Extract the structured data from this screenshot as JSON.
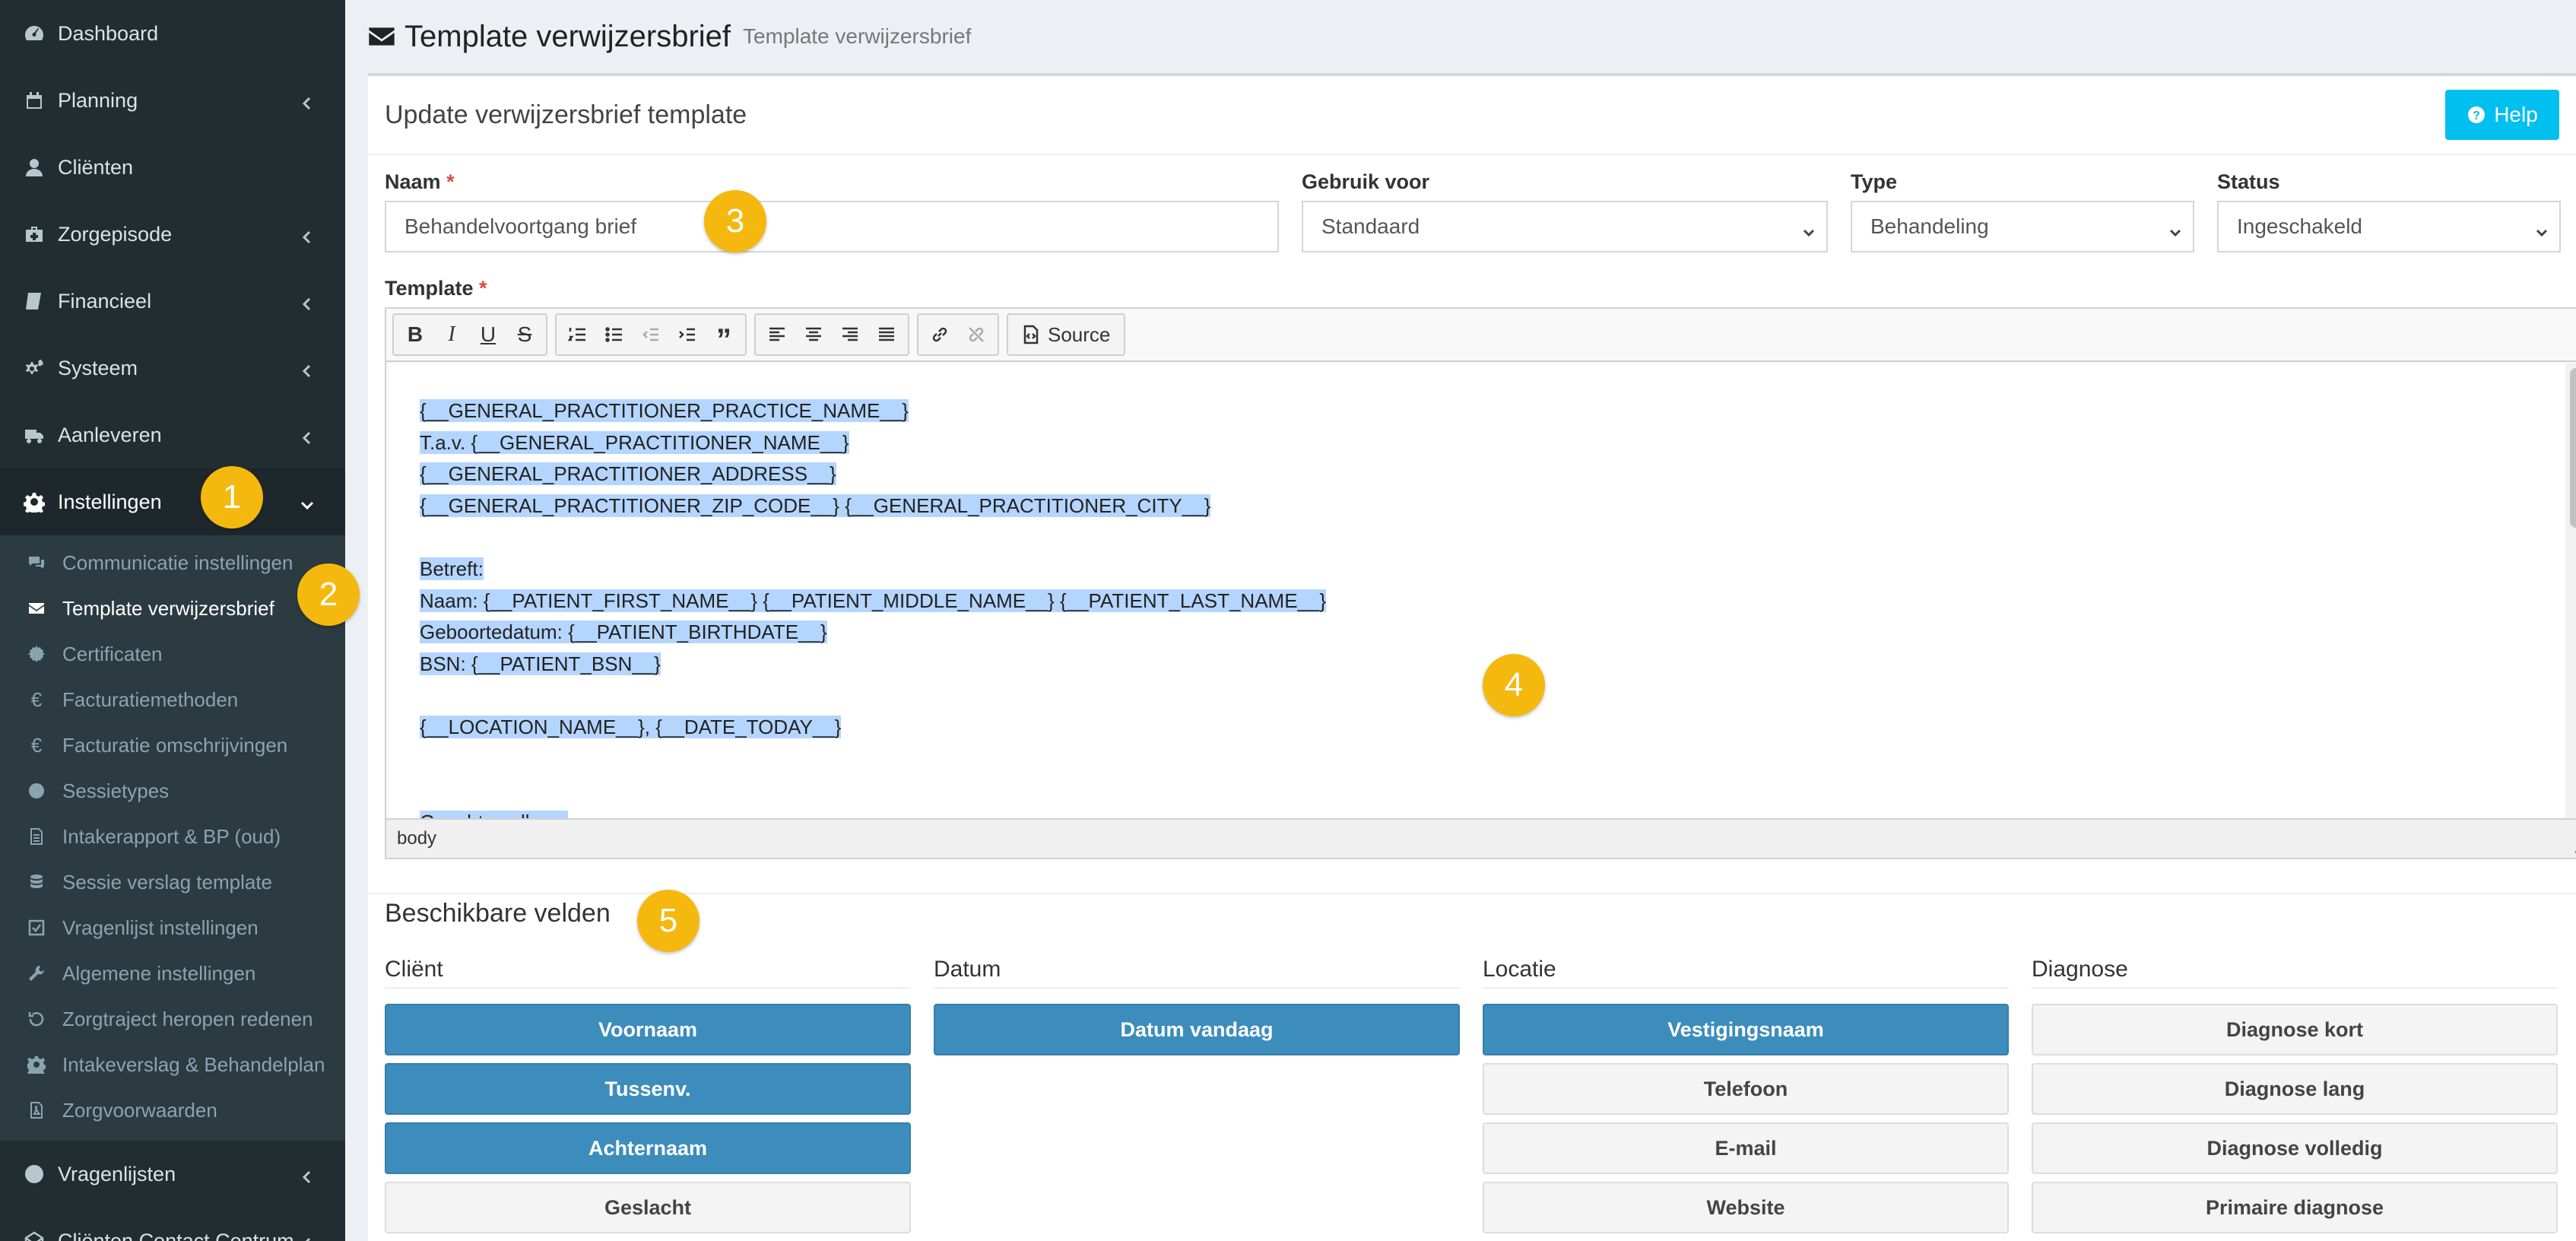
{
  "sidebar": {
    "items": [
      {
        "label": "Dashboard",
        "icon": "dashboard-icon",
        "chevron": false
      },
      {
        "label": "Planning",
        "icon": "calendar-icon",
        "chevron": true
      },
      {
        "label": "Cliënten",
        "icon": "user-icon",
        "chevron": false
      },
      {
        "label": "Zorgepisode",
        "icon": "medkit-icon",
        "chevron": true
      },
      {
        "label": "Financieel",
        "icon": "book-icon",
        "chevron": true
      },
      {
        "label": "Systeem",
        "icon": "cogs-icon",
        "chevron": true
      },
      {
        "label": "Aanleveren",
        "icon": "truck-icon",
        "chevron": true
      },
      {
        "label": "Instellingen",
        "icon": "cog-icon",
        "chevron": true,
        "active": true
      }
    ],
    "submenu": [
      {
        "label": "Communicatie instellingen",
        "icon": "comments-icon"
      },
      {
        "label": "Template verwijzersbrief",
        "icon": "envelope-icon",
        "active": true
      },
      {
        "label": "Certificaten",
        "icon": "certificate-icon"
      },
      {
        "label": "Facturatiemethoden",
        "icon": "euro-icon"
      },
      {
        "label": "Facturatie omschrijvingen",
        "icon": "euro-icon"
      },
      {
        "label": "Sessietypes",
        "icon": "globe-icon"
      },
      {
        "label": "Intakerapport & BP (oud)",
        "icon": "file-text-icon"
      },
      {
        "label": "Sessie verslag template",
        "icon": "database-icon"
      },
      {
        "label": "Vragenlijst instellingen",
        "icon": "check-square-icon"
      },
      {
        "label": "Algemene instellingen",
        "icon": "wrench-icon"
      },
      {
        "label": "Zorgtraject heropen redenen",
        "icon": "history-icon"
      },
      {
        "label": "Intakeverslag & Behandelplan",
        "icon": "cog-icon"
      },
      {
        "label": "Zorgvoorwaarden",
        "icon": "file-pdf-icon"
      }
    ],
    "bottom_items": [
      {
        "label": "Vragenlijsten",
        "icon": "globe-icon",
        "chevron": true
      },
      {
        "label": "Cliënten Contact Centrum",
        "icon": "envelope-open-icon",
        "chevron": true
      }
    ]
  },
  "header": {
    "title": "Template verwijzersbrief",
    "subtitle": "Template verwijzersbrief"
  },
  "box": {
    "title": "Update verwijzersbrief template",
    "help_label": "Help"
  },
  "form": {
    "naam": {
      "label": "Naam",
      "required_mark": "*",
      "value": "Behandelvoortgang brief"
    },
    "gebruik_voor": {
      "label": "Gebruik voor",
      "value": "Standaard"
    },
    "type": {
      "label": "Type",
      "value": "Behandeling"
    },
    "status": {
      "label": "Status",
      "value": "Ingeschakeld"
    },
    "template": {
      "label": "Template",
      "required_mark": "*"
    }
  },
  "editor": {
    "source_label": "Source",
    "path_label": "body",
    "lines": [
      "{__GENERAL_PRACTITIONER_PRACTICE_NAME__}",
      "T.a.v. {__GENERAL_PRACTITIONER_NAME__}",
      "{__GENERAL_PRACTITIONER_ADDRESS__}",
      "{__GENERAL_PRACTITIONER_ZIP_CODE__} {__GENERAL_PRACTITIONER_CITY__}",
      "",
      "Betreft:",
      "Naam: {__PATIENT_FIRST_NAME__} {__PATIENT_MIDDLE_NAME__} {__PATIENT_LAST_NAME__}",
      "Geboortedatum: {__PATIENT_BIRTHDATE__}",
      "BSN: {__PATIENT_BSN__}",
      "",
      "{__LOCATION_NAME__}, {__DATE_TODAY__}",
      "",
      "",
      "Geachte collega,"
    ]
  },
  "fields": {
    "title": "Beschikbare velden",
    "columns": [
      {
        "title": "Cliënt",
        "buttons": [
          {
            "label": "Voornaam",
            "style": "primary"
          },
          {
            "label": "Tussenv.",
            "style": "primary"
          },
          {
            "label": "Achternaam",
            "style": "primary"
          },
          {
            "label": "Geslacht",
            "style": "default"
          }
        ]
      },
      {
        "title": "Datum",
        "buttons": [
          {
            "label": "Datum vandaag",
            "style": "primary"
          }
        ]
      },
      {
        "title": "Locatie",
        "buttons": [
          {
            "label": "Vestigingsnaam",
            "style": "primary"
          },
          {
            "label": "Telefoon",
            "style": "default"
          },
          {
            "label": "E-mail",
            "style": "default"
          },
          {
            "label": "Website",
            "style": "default"
          }
        ]
      },
      {
        "title": "Diagnose",
        "buttons": [
          {
            "label": "Diagnose kort",
            "style": "default"
          },
          {
            "label": "Diagnose lang",
            "style": "default"
          },
          {
            "label": "Diagnose volledig",
            "style": "default"
          },
          {
            "label": "Primaire diagnose",
            "style": "default"
          }
        ]
      }
    ]
  },
  "badges": [
    "1",
    "2",
    "3",
    "4",
    "5"
  ],
  "colors": {
    "sidebar_bg": "#222d32",
    "submenu_bg": "#2c3b41",
    "primary": "#3c8dbc",
    "help": "#00c0ef",
    "badge": "#f5b80f",
    "selection": "#b4d5fe"
  }
}
